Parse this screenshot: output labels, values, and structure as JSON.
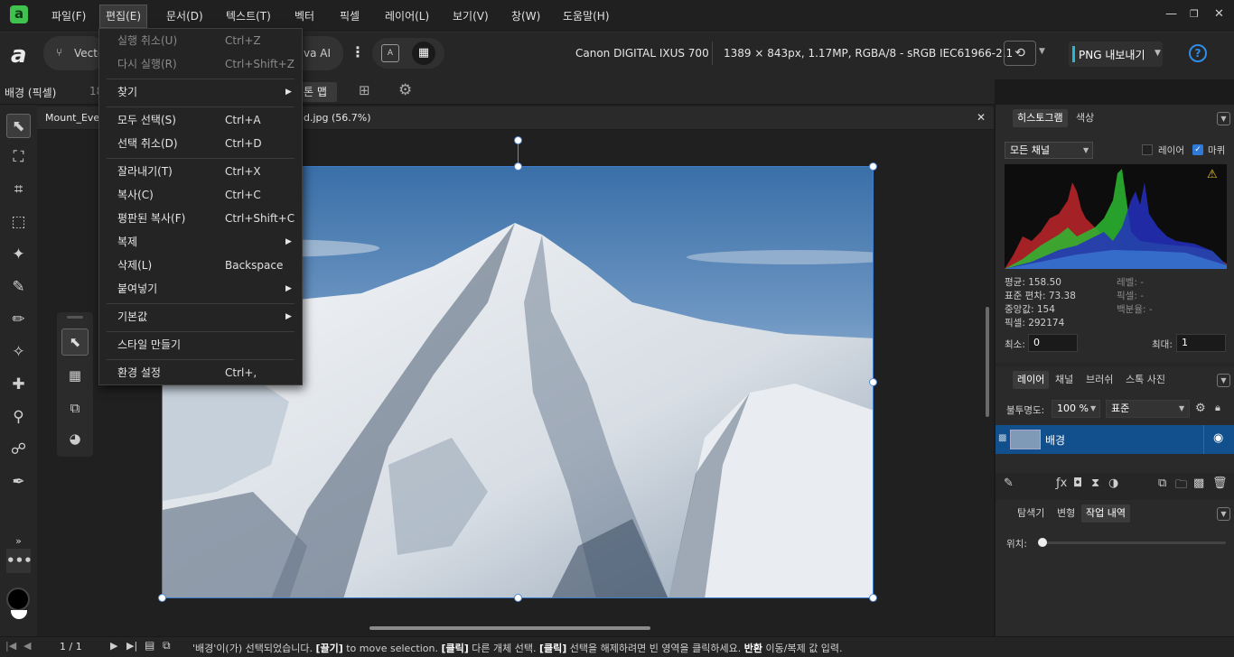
{
  "menubar": {
    "items": [
      "파일(F)",
      "편집(E)",
      "문서(D)",
      "텍스트(T)",
      "벡터",
      "픽셀",
      "레이어(L)",
      "보기(V)",
      "창(W)",
      "도움말(H)"
    ],
    "active": "편집(E)"
  },
  "toolbar": {
    "vector_label": "Vecto",
    "canva_label": "va AI",
    "camera": "Canon DIGITAL IXUS 700",
    "image_info": "1389 × 843px, 1.17MP, RGBA/8 - sRGB IEC61966-2.1",
    "export_label": "PNG 내보내기"
  },
  "context": {
    "layer_label": "배경 (픽셀)",
    "num": "18",
    "tone_map": "톤 맵"
  },
  "document": {
    "tab_left": "Mount_Ever",
    "tab_right": "d.jpg (56.7%)"
  },
  "edit_menu": [
    {
      "label": "실행 취소(U)",
      "shortcut": "Ctrl+Z",
      "disabled": true
    },
    {
      "label": "다시 실행(R)",
      "shortcut": "Ctrl+Shift+Z",
      "disabled": true
    },
    {
      "label": "찾기",
      "shortcut": "",
      "submenu": true
    },
    {
      "label": "모두 선택(S)",
      "shortcut": "Ctrl+A"
    },
    {
      "label": "선택 취소(D)",
      "shortcut": "Ctrl+D"
    },
    {
      "label": "잘라내기(T)",
      "shortcut": "Ctrl+X"
    },
    {
      "label": "복사(C)",
      "shortcut": "Ctrl+C"
    },
    {
      "label": "평판된 복사(F)",
      "shortcut": "Ctrl+Shift+C"
    },
    {
      "label": "복제",
      "shortcut": "",
      "submenu": true
    },
    {
      "label": "삭제(L)",
      "shortcut": "Backspace"
    },
    {
      "label": "붙여넣기",
      "shortcut": "",
      "submenu": true
    },
    {
      "label": "기본값",
      "shortcut": "",
      "submenu": true
    },
    {
      "label": "스타일 만들기",
      "shortcut": ""
    },
    {
      "label": "환경 설정",
      "shortcut": "Ctrl+,"
    }
  ],
  "histogram": {
    "tab_active": "히스토그램",
    "tab_other": "색상",
    "channel": "모든 채널",
    "layer_label": "레이어",
    "marquee_label": "마퀴",
    "stats_left": [
      "평균: 158.50",
      "표준 편차: 73.38",
      "중앙값: 154",
      "픽셀: 292174"
    ],
    "stats_right": [
      "레벨: -",
      "픽셀: -",
      "백분율: -"
    ],
    "min_label": "최소:",
    "min_value": "0",
    "max_label": "최대:",
    "max_value": "1"
  },
  "layers": {
    "tabs": [
      "레이어",
      "채널",
      "브러쉬",
      "스톡 사진"
    ],
    "opacity_label": "불투명도:",
    "opacity_value": "100 %",
    "blend_mode": "표준",
    "layer_name": "배경"
  },
  "history": {
    "tabs": [
      "탐색기",
      "변형",
      "작업 내역"
    ],
    "active": "작업 내역",
    "position_label": "위치:"
  },
  "status": {
    "page": "1 / 1",
    "message_parts": [
      "'배경'이(가) 선택되었습니다. ",
      "[끌기]",
      " to move selection. ",
      "[클릭]",
      " 다른 개체 선택. ",
      "[클릭]",
      " 선택을 해제하려면 빈 영역을 클릭하세요. ",
      "반환",
      " 이동/복제 값 입력."
    ]
  },
  "icons": [
    "search-icon",
    "help-icon",
    "eye-icon",
    "lock-icon",
    "gear-icon",
    "trash-icon",
    "pointer-icon",
    "crop-icon",
    "brush-icon"
  ],
  "colors": {
    "accent": "#2f7ad6",
    "green_logo": "#3fc24e",
    "selection": "#11508c"
  }
}
